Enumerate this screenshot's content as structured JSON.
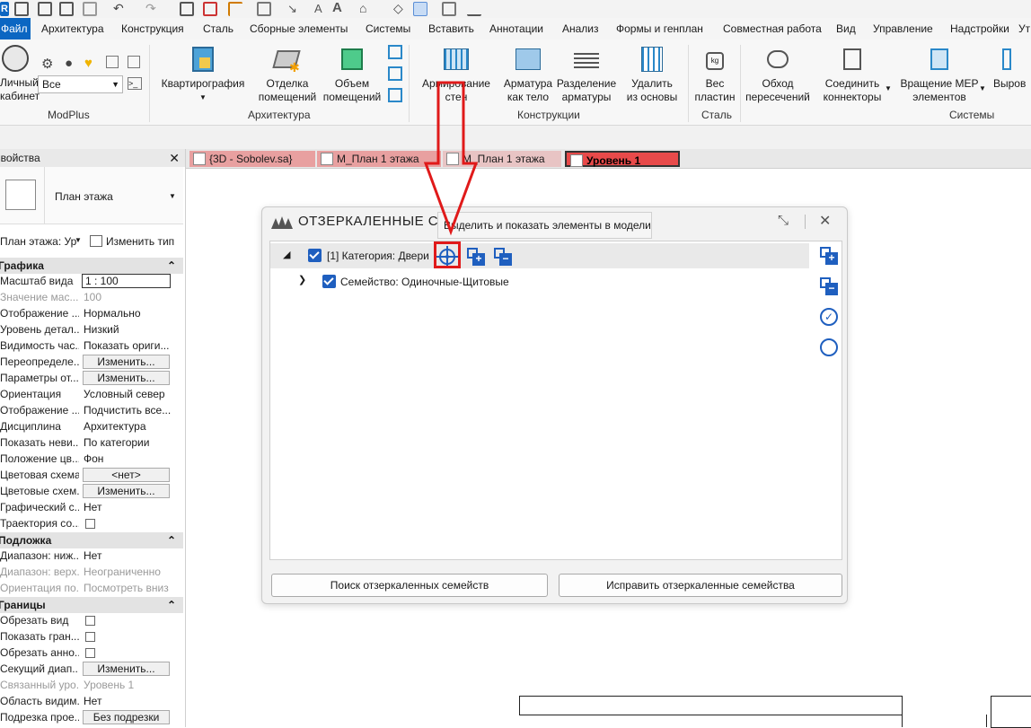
{
  "ribbon_tabs": {
    "file": "Файл",
    "items": [
      "Архитектура",
      "Конструкция",
      "Сталь",
      "Сборные элементы",
      "Системы",
      "Вставить",
      "Аннотации",
      "Анализ",
      "Формы и генплан",
      "Совместная работа",
      "Вид",
      "Управление",
      "Надстройки",
      "Ут"
    ]
  },
  "modplus": {
    "cabinet_l1": "Личный",
    "cabinet_l2": "кабинет",
    "combo": "Все",
    "group": "ModPlus"
  },
  "arch": {
    "kvart": "Квартирография",
    "otdelka_l1": "Отделка",
    "otdelka_l2": "помещений",
    "obem_l1": "Объем",
    "obem_l2": "помещений",
    "group": "Архитектура"
  },
  "konstr": {
    "armir_l1": "Армирование",
    "armir_l2": "стен",
    "armat_l1": "Арматура",
    "armat_l2": "как тело",
    "razd_l1": "Разделение",
    "razd_l2": "арматуры",
    "udal_l1": "Удалить",
    "udal_l2": "из основы",
    "group": "Конструкции"
  },
  "stal": {
    "ves_l1": "Вес",
    "ves_l2": "пластин",
    "group": "Сталь"
  },
  "sys": {
    "obhod_l1": "Обход",
    "obhod_l2": "пересечений",
    "soed_l1": "Соединить",
    "soed_l2": "коннекторы",
    "vrasch_l1": "Вращение MEP",
    "vrasch_l2": "элементов",
    "vyrov": "Выров",
    "group": "Системы"
  },
  "view_tabs": [
    "{3D - Sobolev.sa}",
    "М_План 1 этажа",
    "М_План 1 этажа",
    "Уровень 1"
  ],
  "props": {
    "header": "Свойства",
    "type_name": "План этажа",
    "selector": "План этажа: Ур",
    "edit_type": "Изменить тип",
    "sections": {
      "graphics": "Графика",
      "underlay": "Подложка",
      "bounds": "Границы"
    },
    "rows": [
      {
        "k": "Масштаб вида",
        "v": "1 : 100"
      },
      {
        "k": "Значение мас...",
        "v": "100"
      },
      {
        "k": "Отображение ...",
        "v": "Нормально"
      },
      {
        "k": "Уровень детал...",
        "v": "Низкий"
      },
      {
        "k": "Видимость час...",
        "v": "Показать ориги..."
      },
      {
        "k": "Переопределе...",
        "v": "Изменить..."
      },
      {
        "k": "Параметры от...",
        "v": "Изменить..."
      },
      {
        "k": "Ориентация",
        "v": "Условный север"
      },
      {
        "k": "Отображение ...",
        "v": "Подчистить все..."
      },
      {
        "k": "Дисциплина",
        "v": "Архитектура"
      },
      {
        "k": "Показать неви...",
        "v": "По категории"
      },
      {
        "k": "Положение цв...",
        "v": "Фон"
      },
      {
        "k": "Цветовая схема",
        "v": "<нет>"
      },
      {
        "k": "Цветовые схем...",
        "v": "Изменить..."
      },
      {
        "k": "Графический с...",
        "v": "Нет"
      },
      {
        "k": "Траектория со...",
        "v": ""
      },
      {
        "k": "Диапазон: ниж...",
        "v": "Нет"
      },
      {
        "k": "Диапазон: верх...",
        "v": "Неограниченно"
      },
      {
        "k": "Ориентация по...",
        "v": "Посмотреть вниз"
      },
      {
        "k": "Обрезать вид",
        "v": ""
      },
      {
        "k": "Показать гран...",
        "v": ""
      },
      {
        "k": "Обрезать анно...",
        "v": ""
      },
      {
        "k": "Секущий диап...",
        "v": "Изменить..."
      },
      {
        "k": "Связанный уро...",
        "v": "Уровень 1"
      },
      {
        "k": "Область видим...",
        "v": "Нет"
      },
      {
        "k": "Подрезка прое...",
        "v": "Без подрезки"
      }
    ]
  },
  "dialog": {
    "title": "ОТЗЕРКАЛЕННЫЕ СЕМ",
    "tooltip": "Выделить и показать элементы в модели",
    "tree": {
      "category": "[1] Категория: Двери",
      "family": "Семейство: Одиночные-Щитовые"
    },
    "btn_search": "Поиск отзеркаленных семейств",
    "btn_fix": "Исправить отзеркаленные семейства"
  },
  "colors": {
    "accent": "#1f5fbf",
    "annotation": "#e01a1a",
    "active_tab": "#e84a4a"
  }
}
